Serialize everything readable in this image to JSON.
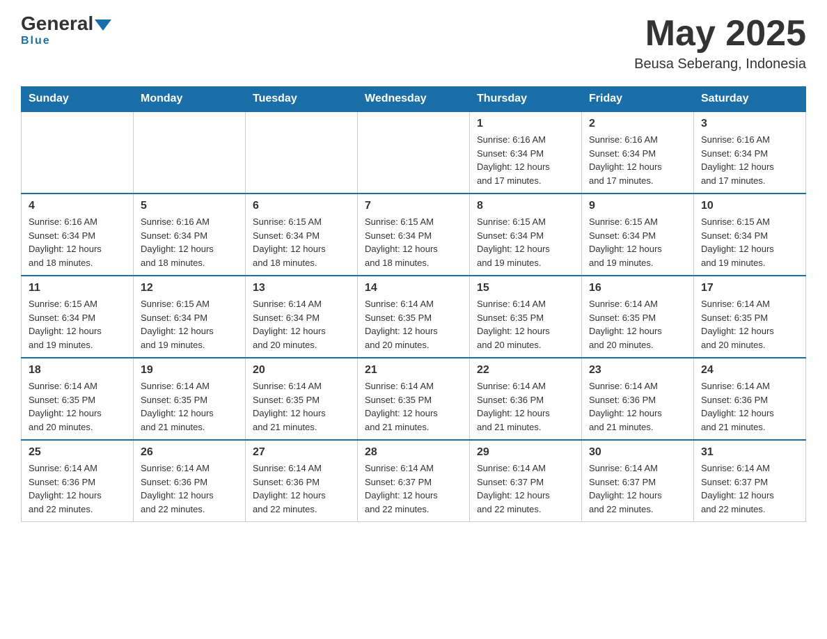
{
  "logo": {
    "general": "General",
    "blue": "Blue",
    "underline": "Blue"
  },
  "header": {
    "month_year": "May 2025",
    "location": "Beusa Seberang, Indonesia"
  },
  "weekdays": [
    "Sunday",
    "Monday",
    "Tuesday",
    "Wednesday",
    "Thursday",
    "Friday",
    "Saturday"
  ],
  "weeks": [
    [
      {
        "day": "",
        "info": ""
      },
      {
        "day": "",
        "info": ""
      },
      {
        "day": "",
        "info": ""
      },
      {
        "day": "",
        "info": ""
      },
      {
        "day": "1",
        "info": "Sunrise: 6:16 AM\nSunset: 6:34 PM\nDaylight: 12 hours\nand 17 minutes."
      },
      {
        "day": "2",
        "info": "Sunrise: 6:16 AM\nSunset: 6:34 PM\nDaylight: 12 hours\nand 17 minutes."
      },
      {
        "day": "3",
        "info": "Sunrise: 6:16 AM\nSunset: 6:34 PM\nDaylight: 12 hours\nand 17 minutes."
      }
    ],
    [
      {
        "day": "4",
        "info": "Sunrise: 6:16 AM\nSunset: 6:34 PM\nDaylight: 12 hours\nand 18 minutes."
      },
      {
        "day": "5",
        "info": "Sunrise: 6:16 AM\nSunset: 6:34 PM\nDaylight: 12 hours\nand 18 minutes."
      },
      {
        "day": "6",
        "info": "Sunrise: 6:15 AM\nSunset: 6:34 PM\nDaylight: 12 hours\nand 18 minutes."
      },
      {
        "day": "7",
        "info": "Sunrise: 6:15 AM\nSunset: 6:34 PM\nDaylight: 12 hours\nand 18 minutes."
      },
      {
        "day": "8",
        "info": "Sunrise: 6:15 AM\nSunset: 6:34 PM\nDaylight: 12 hours\nand 19 minutes."
      },
      {
        "day": "9",
        "info": "Sunrise: 6:15 AM\nSunset: 6:34 PM\nDaylight: 12 hours\nand 19 minutes."
      },
      {
        "day": "10",
        "info": "Sunrise: 6:15 AM\nSunset: 6:34 PM\nDaylight: 12 hours\nand 19 minutes."
      }
    ],
    [
      {
        "day": "11",
        "info": "Sunrise: 6:15 AM\nSunset: 6:34 PM\nDaylight: 12 hours\nand 19 minutes."
      },
      {
        "day": "12",
        "info": "Sunrise: 6:15 AM\nSunset: 6:34 PM\nDaylight: 12 hours\nand 19 minutes."
      },
      {
        "day": "13",
        "info": "Sunrise: 6:14 AM\nSunset: 6:34 PM\nDaylight: 12 hours\nand 20 minutes."
      },
      {
        "day": "14",
        "info": "Sunrise: 6:14 AM\nSunset: 6:35 PM\nDaylight: 12 hours\nand 20 minutes."
      },
      {
        "day": "15",
        "info": "Sunrise: 6:14 AM\nSunset: 6:35 PM\nDaylight: 12 hours\nand 20 minutes."
      },
      {
        "day": "16",
        "info": "Sunrise: 6:14 AM\nSunset: 6:35 PM\nDaylight: 12 hours\nand 20 minutes."
      },
      {
        "day": "17",
        "info": "Sunrise: 6:14 AM\nSunset: 6:35 PM\nDaylight: 12 hours\nand 20 minutes."
      }
    ],
    [
      {
        "day": "18",
        "info": "Sunrise: 6:14 AM\nSunset: 6:35 PM\nDaylight: 12 hours\nand 20 minutes."
      },
      {
        "day": "19",
        "info": "Sunrise: 6:14 AM\nSunset: 6:35 PM\nDaylight: 12 hours\nand 21 minutes."
      },
      {
        "day": "20",
        "info": "Sunrise: 6:14 AM\nSunset: 6:35 PM\nDaylight: 12 hours\nand 21 minutes."
      },
      {
        "day": "21",
        "info": "Sunrise: 6:14 AM\nSunset: 6:35 PM\nDaylight: 12 hours\nand 21 minutes."
      },
      {
        "day": "22",
        "info": "Sunrise: 6:14 AM\nSunset: 6:36 PM\nDaylight: 12 hours\nand 21 minutes."
      },
      {
        "day": "23",
        "info": "Sunrise: 6:14 AM\nSunset: 6:36 PM\nDaylight: 12 hours\nand 21 minutes."
      },
      {
        "day": "24",
        "info": "Sunrise: 6:14 AM\nSunset: 6:36 PM\nDaylight: 12 hours\nand 21 minutes."
      }
    ],
    [
      {
        "day": "25",
        "info": "Sunrise: 6:14 AM\nSunset: 6:36 PM\nDaylight: 12 hours\nand 22 minutes."
      },
      {
        "day": "26",
        "info": "Sunrise: 6:14 AM\nSunset: 6:36 PM\nDaylight: 12 hours\nand 22 minutes."
      },
      {
        "day": "27",
        "info": "Sunrise: 6:14 AM\nSunset: 6:36 PM\nDaylight: 12 hours\nand 22 minutes."
      },
      {
        "day": "28",
        "info": "Sunrise: 6:14 AM\nSunset: 6:37 PM\nDaylight: 12 hours\nand 22 minutes."
      },
      {
        "day": "29",
        "info": "Sunrise: 6:14 AM\nSunset: 6:37 PM\nDaylight: 12 hours\nand 22 minutes."
      },
      {
        "day": "30",
        "info": "Sunrise: 6:14 AM\nSunset: 6:37 PM\nDaylight: 12 hours\nand 22 minutes."
      },
      {
        "day": "31",
        "info": "Sunrise: 6:14 AM\nSunset: 6:37 PM\nDaylight: 12 hours\nand 22 minutes."
      }
    ]
  ],
  "colors": {
    "header_bg": "#1a6fa8",
    "header_text": "#ffffff",
    "border": "#cccccc",
    "accent": "#1a6fa8"
  }
}
